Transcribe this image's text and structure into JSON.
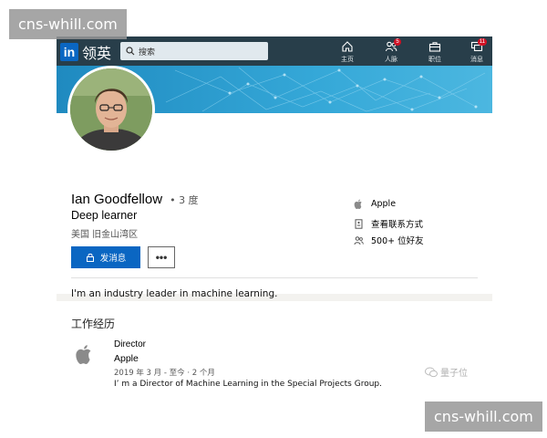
{
  "watermarks": {
    "top": "cns-whill.com",
    "bottom": "cns-whill.com"
  },
  "nav": {
    "logo_text": "领英",
    "logo_badge": "in",
    "search_placeholder": "搜索",
    "items": [
      {
        "label": "主页",
        "icon": "home-icon",
        "badge": ""
      },
      {
        "label": "人脉",
        "icon": "people-icon",
        "badge": "5"
      },
      {
        "label": "职位",
        "icon": "briefcase-icon",
        "badge": ""
      },
      {
        "label": "消息",
        "icon": "messages-icon",
        "badge": "11"
      }
    ]
  },
  "profile": {
    "name": "Ian Goodfellow",
    "degree": "• 3 度",
    "headline": "Deep learner",
    "location": "美国 旧金山湾区",
    "message_button": "发消息",
    "more_button": "•••",
    "side": {
      "company": "Apple",
      "contact": "查看联系方式",
      "connections": "500+ 位好友"
    },
    "summary": "I'm an industry leader in machine learning."
  },
  "experience": {
    "title": "工作经历",
    "items": [
      {
        "role": "Director",
        "company": "Apple",
        "dates": "2019 年 3 月 - 至今 · 2 个月",
        "description": "I’ m a Director of Machine Learning in the Special Projects Group."
      }
    ]
  },
  "wechat_watermark": "量子位",
  "colors": {
    "nav_bg": "#283e4a",
    "primary": "#0a66c2",
    "banner": "#35a8d8"
  }
}
